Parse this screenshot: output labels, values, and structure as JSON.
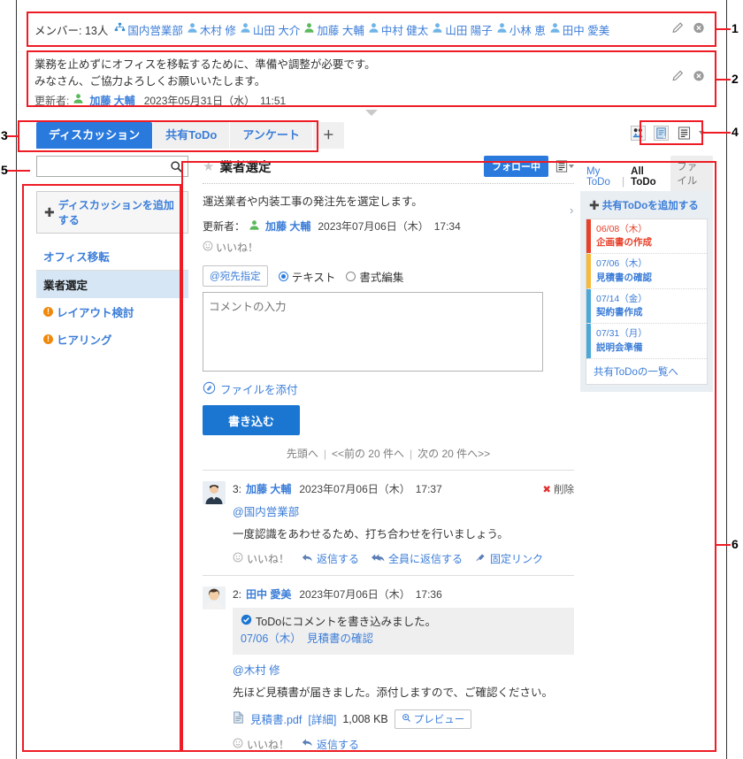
{
  "member_bar": {
    "label": "メンバー: 13人",
    "members": [
      {
        "name": "国内営業部",
        "icon": "org-icon"
      },
      {
        "name": "木村 修",
        "icon": "user-icon"
      },
      {
        "name": "山田 大介",
        "icon": "user-icon"
      },
      {
        "name": "加藤 大輔",
        "icon": "user-icon-green"
      },
      {
        "name": "中村 健太",
        "icon": "user-icon"
      },
      {
        "name": "山田 陽子",
        "icon": "user-icon"
      },
      {
        "name": "小林 恵",
        "icon": "user-icon"
      },
      {
        "name": "田中 愛美",
        "icon": "user-icon"
      }
    ],
    "edit_icon": "pencil-icon",
    "delete_icon": "remove-circle-icon"
  },
  "description": {
    "line1": "業務を止めずにオフィスを移転するために、準備や調整が必要です。",
    "line2": "みなさん、ご協力よろしくお願いいたします。",
    "updater_label": "更新者:",
    "updater_name": "加藤 大輔",
    "updated_at": "2023年05月31日（水）　11:51",
    "edit_icon": "pencil-icon",
    "delete_icon": "remove-circle-icon"
  },
  "tabs": [
    {
      "label": "ディスカッション",
      "active": true
    },
    {
      "label": "共有ToDo",
      "active": false
    },
    {
      "label": "アンケート",
      "active": false
    },
    {
      "label": "＋",
      "active": false,
      "is_plus": true
    }
  ],
  "toolbar_icons": [
    {
      "name": "members-icon"
    },
    {
      "name": "notes-icon"
    },
    {
      "name": "menu-list-icon"
    }
  ],
  "sidebar": {
    "search_placeholder": "",
    "search_value": "",
    "search_icon": "search-icon",
    "add_discussion": "ディスカッションを追加する",
    "group_title": "オフィス移転",
    "items": [
      {
        "label": "業者選定",
        "selected": true,
        "badge": false
      },
      {
        "label": "レイアウト検討",
        "selected": false,
        "badge": true
      },
      {
        "label": "ヒアリング",
        "selected": false,
        "badge": true
      }
    ]
  },
  "topic": {
    "star_icon": "star-icon",
    "title": "業者選定",
    "follow_label": "フォロー中",
    "menu_icon": "menu-list-icon",
    "description": "運送業者や内装工事の発注先を選定します。",
    "updater_label": "更新者：",
    "updater_name": "加藤 大輔",
    "updated_at": "2023年07月06日（木）　17:34",
    "like_label": "いいね！"
  },
  "compose": {
    "address_btn": "宛先指定",
    "mode_text": "テキスト",
    "mode_rich": "書式編集",
    "selected_mode": "text",
    "textarea_placeholder": "コメントの入力",
    "textarea_value": "",
    "attach_label": "ファイルを添付",
    "submit_label": "書き込む"
  },
  "pager": {
    "first": "先頭へ",
    "prev": "<<前の 20 件へ",
    "next": "次の 20 件へ>>"
  },
  "comments": [
    {
      "no": "3:",
      "name": "加藤 大輔",
      "date": "2023年07月06日（木）　17:37",
      "delete_label": "削除",
      "mention": "@国内営業部",
      "text": "一度認識をあわせるため、打ち合わせを行いましょう。",
      "actions": [
        {
          "label": "いいね！",
          "icon": "smile-icon",
          "gray": true
        },
        {
          "label": "返信する",
          "icon": "reply-icon",
          "gray": false
        },
        {
          "label": "全員に返信する",
          "icon": "reply-all-icon",
          "gray": false
        },
        {
          "label": "固定リンク",
          "icon": "link-icon",
          "gray": false
        }
      ]
    },
    {
      "no": "2:",
      "name": "田中 愛美",
      "date": "2023年07月06日（木）　17:36",
      "delete_label": "",
      "quote": {
        "line1": "ToDoにコメントを書き込みました。",
        "line2": "07/06（木）　見積書の確認",
        "icon": "check-circle-icon"
      },
      "mention": "@木村 修",
      "text": "先ほど見積書が届きました。添付しますので、ご確認ください。",
      "file": {
        "icon": "file-icon",
        "name": "見積書.pdf",
        "detail": "[詳細]",
        "size": "1,008 KB",
        "preview_label": "プレビュー",
        "preview_icon": "zoom-icon"
      },
      "actions": [
        {
          "label": "いいね！",
          "icon": "smile-icon",
          "gray": true
        },
        {
          "label": "返信する",
          "icon": "reply-icon",
          "gray": false
        }
      ]
    }
  ],
  "todo_panel": {
    "tabs": [
      {
        "label": "My ToDo",
        "current": false
      },
      {
        "label": "All ToDo",
        "current": true
      },
      {
        "label": "ファイル",
        "current": false,
        "is_file": true
      }
    ],
    "collapse_icon": "chevron-right-icon",
    "add_label": "共有ToDoを追加する",
    "items": [
      {
        "date": "06/08（木）",
        "title": "企画書の作成",
        "color": "#e8402a",
        "text_color": "#e8402a"
      },
      {
        "date": "07/06（木）",
        "title": "見積書の確認",
        "color": "#f6b93b",
        "text_color": "#3b7dd8"
      },
      {
        "date": "07/14（金）",
        "title": "契約書作成",
        "color": "#4aa8d8",
        "text_color": "#3b7dd8"
      },
      {
        "date": "07/31（月）",
        "title": "説明会準備",
        "color": "#4aa8d8",
        "text_color": "#3b7dd8"
      }
    ],
    "more_label": "共有ToDoの一覧へ"
  },
  "annotations": [
    {
      "num": "1"
    },
    {
      "num": "2"
    },
    {
      "num": "3"
    },
    {
      "num": "4"
    },
    {
      "num": "5"
    },
    {
      "num": "6"
    }
  ],
  "colors": {
    "accent_blue": "#2a7ade",
    "link_blue": "#3b7dd8",
    "anno_red": "#ee1c25",
    "selected_row": "#d6e6f5"
  }
}
